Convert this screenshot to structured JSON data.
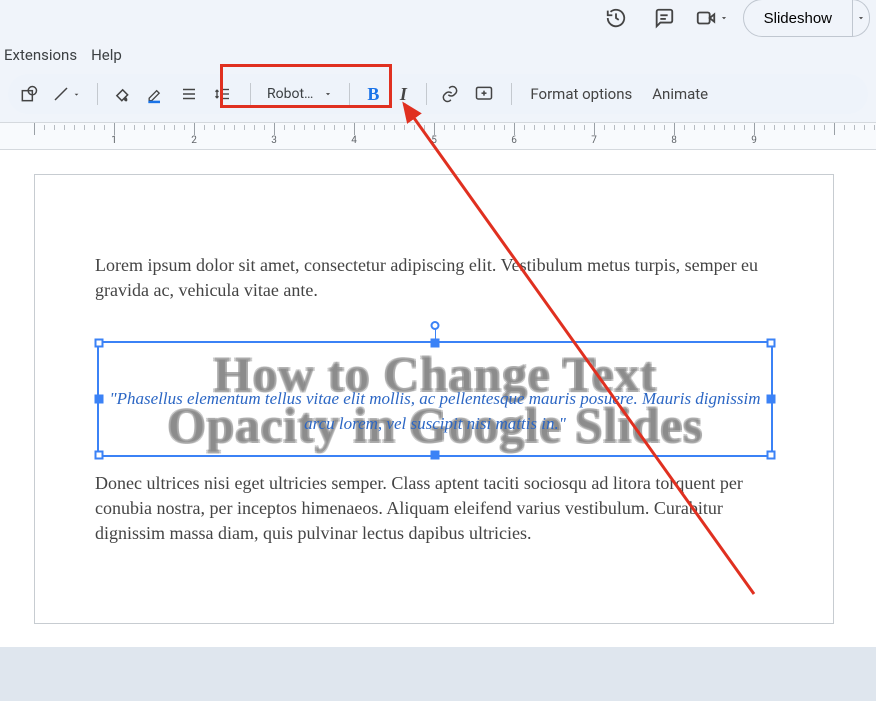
{
  "top": {
    "slideshow_label": "Slideshow"
  },
  "menu": {
    "extensions": "Extensions",
    "help": "Help"
  },
  "toolbar": {
    "font_name": "Robot…",
    "bold": "B",
    "italic": "I",
    "format_options": "Format options",
    "animate": "Animate"
  },
  "ruler": {
    "labels": [
      "1",
      "2",
      "3",
      "4",
      "5",
      "6",
      "7",
      "8",
      "9"
    ]
  },
  "slide": {
    "para1": "Lorem ipsum dolor sit amet, consectetur adipiscing elit. Vestibulum metus turpis, semper eu gravida ac, vehicula vitae ante.",
    "quote": "\"Phasellus elementum tellus vitae elit mollis, ac pellentesque mauris posuere. Mauris dignissim arcu lorem, vel suscipit nisi mattis in.\"",
    "wordart": "How to Change Text\nOpacity in Google Slides",
    "para2": "Donec ultrices nisi eget ultricies semper. Class aptent taciti sociosqu ad litora torquent per conubia nostra, per inceptos himenaeos. Aliquam eleifend varius vestibulum. Curabitur dignissim massa diam, quis pulvinar lectus dapibus ultricies."
  }
}
